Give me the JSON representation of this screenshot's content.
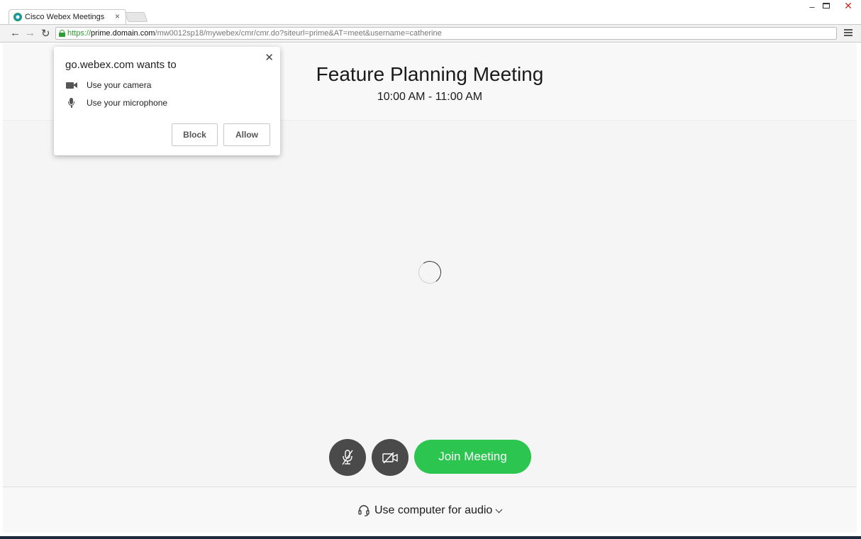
{
  "browser": {
    "tab_title": "Cisco Webex Meetings",
    "tab_close": "×",
    "url_scheme": "https://",
    "url_host": "prime.domain.com",
    "url_path": "/mw0012sp18/mywebex/cmr/cmr.do?siteurl=prime&AT=meet&username=catherine",
    "window_controls": {
      "minimize": "–",
      "close": "✕"
    }
  },
  "permission_popup": {
    "title": "go.webex.com wants to",
    "close": "✕",
    "camera": "Use your camera",
    "microphone": "Use your microphone",
    "block_label": "Block",
    "allow_label": "Allow"
  },
  "meeting": {
    "title": "Feature Planning Meeting",
    "time": "10:00 AM - 11:00 AM"
  },
  "controls": {
    "join_label": "Join Meeting",
    "audio_option": "Use computer for audio",
    "mute_icon": "muted-microphone-icon",
    "video_icon": "video-off-icon"
  },
  "colors": {
    "join_green": "#2bc54f",
    "control_dark": "#4a4a4a",
    "secure_green": "#2e9b35"
  }
}
